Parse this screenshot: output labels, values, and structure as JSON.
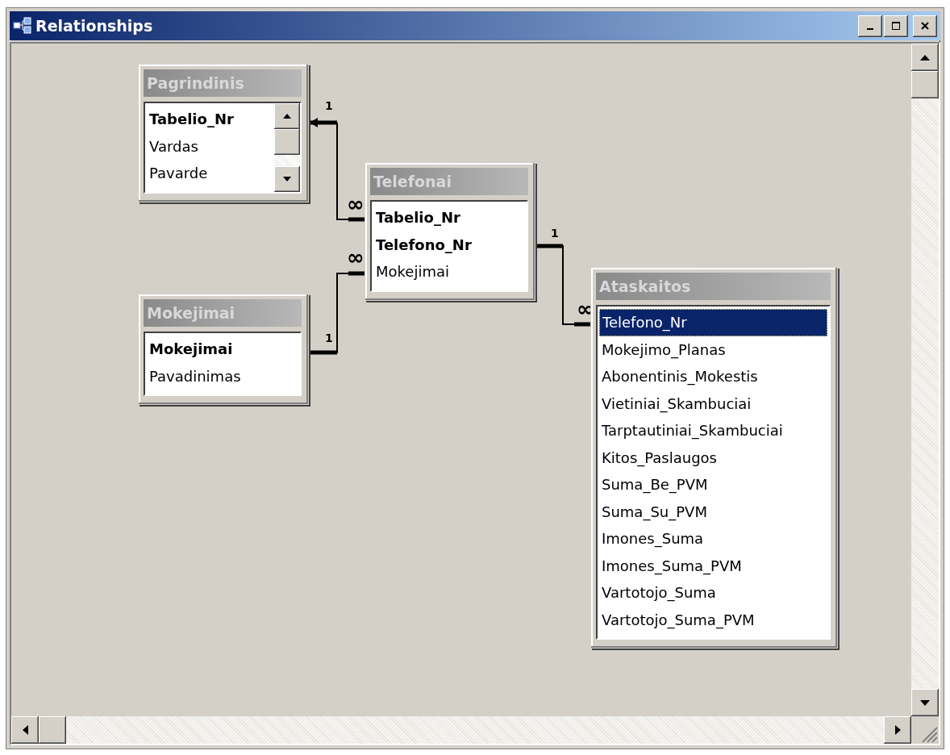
{
  "window": {
    "title": "Relationships"
  },
  "tables": [
    {
      "name": "Pagrindinis",
      "scrollbar": true,
      "fields": [
        {
          "name": "Tabelio_Nr",
          "key": true,
          "selected": false
        },
        {
          "name": "Vardas",
          "key": false,
          "selected": false
        },
        {
          "name": "Pavarde",
          "key": false,
          "selected": false
        }
      ]
    },
    {
      "name": "Telefonai",
      "scrollbar": false,
      "fields": [
        {
          "name": "Tabelio_Nr",
          "key": true,
          "selected": false
        },
        {
          "name": "Telefono_Nr",
          "key": true,
          "selected": false
        },
        {
          "name": "Mokejimai",
          "key": false,
          "selected": false
        }
      ]
    },
    {
      "name": "Mokejimai",
      "scrollbar": false,
      "fields": [
        {
          "name": "Mokejimai",
          "key": true,
          "selected": false
        },
        {
          "name": "Pavadinimas",
          "key": false,
          "selected": false
        }
      ]
    },
    {
      "name": "Ataskaitos",
      "scrollbar": false,
      "fields": [
        {
          "name": "Telefono_Nr",
          "key": false,
          "selected": true
        },
        {
          "name": "Mokejimo_Planas",
          "key": false,
          "selected": false
        },
        {
          "name": "Abonentinis_Mokestis",
          "key": false,
          "selected": false
        },
        {
          "name": "Vietiniai_Skambuciai",
          "key": false,
          "selected": false
        },
        {
          "name": "Tarptautiniai_Skambuciai",
          "key": false,
          "selected": false
        },
        {
          "name": "Kitos_Paslaugos",
          "key": false,
          "selected": false
        },
        {
          "name": "Suma_Be_PVM",
          "key": false,
          "selected": false
        },
        {
          "name": "Suma_Su_PVM",
          "key": false,
          "selected": false
        },
        {
          "name": "Imones_Suma",
          "key": false,
          "selected": false
        },
        {
          "name": "Imones_Suma_PVM",
          "key": false,
          "selected": false
        },
        {
          "name": "Vartotojo_Suma",
          "key": false,
          "selected": false
        },
        {
          "name": "Vartotojo_Suma_PVM",
          "key": false,
          "selected": false
        }
      ]
    }
  ],
  "relationships": [
    {
      "one_label": "1",
      "many_label": "∞"
    },
    {
      "one_label": "1",
      "many_label": "∞"
    },
    {
      "one_label": "1",
      "many_label": "∞"
    }
  ]
}
